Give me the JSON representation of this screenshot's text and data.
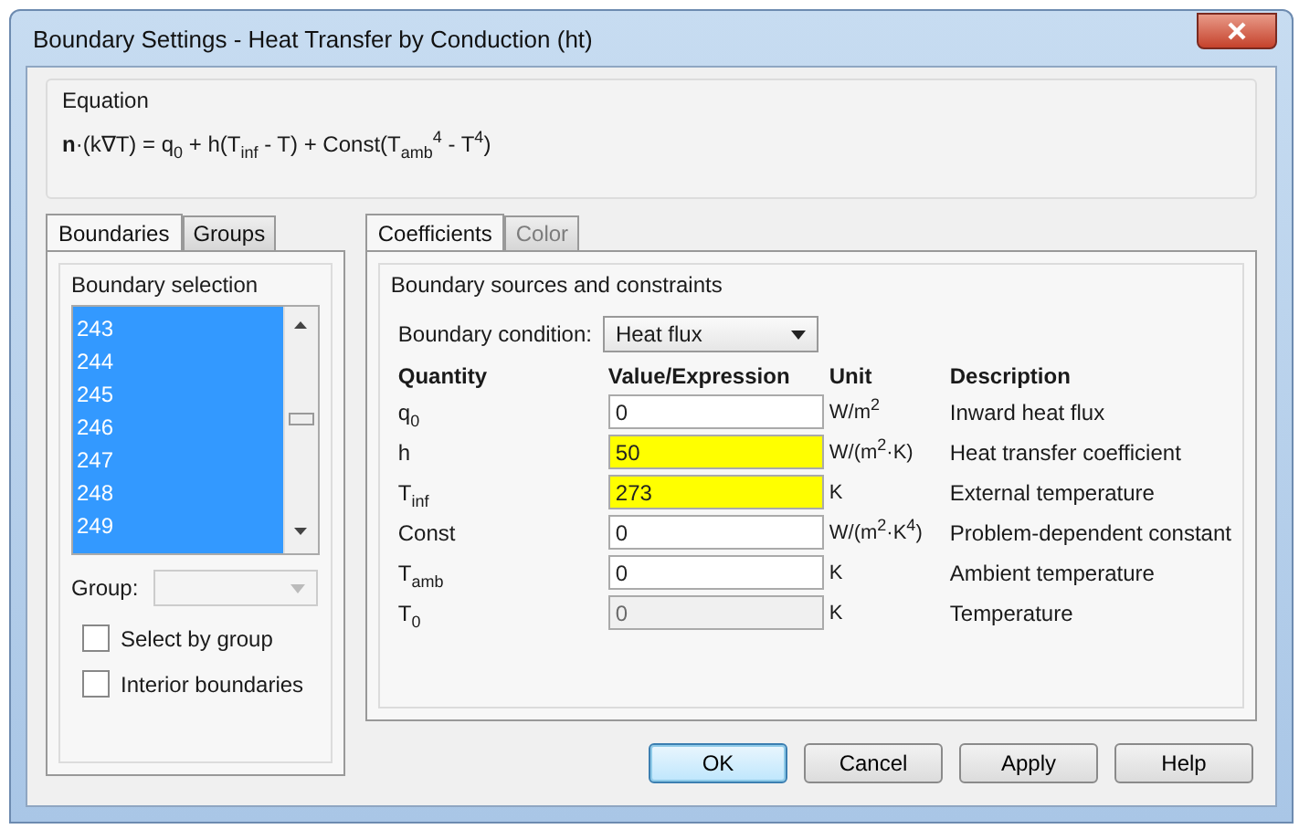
{
  "window": {
    "title": "Boundary Settings - Heat Transfer by Conduction (ht)"
  },
  "equation": {
    "label": "Equation",
    "formula": "**n**·(k∇T) = q$_{0}$ + h(T$_{inf}$ - T) + Const(T$_{amb}$$^{4}$ - T$^{4}$)"
  },
  "left_tabs": [
    {
      "label": "Boundaries",
      "selected": true
    },
    {
      "label": "Groups",
      "selected": false
    }
  ],
  "boundary_selection": {
    "label": "Boundary selection",
    "items": [
      {
        "label": "243",
        "selected": true
      },
      {
        "label": "244",
        "selected": true
      },
      {
        "label": "245",
        "selected": true
      },
      {
        "label": "246",
        "selected": true
      },
      {
        "label": "247",
        "selected": true
      },
      {
        "label": "248",
        "selected": true
      },
      {
        "label": "249",
        "selected": true
      }
    ]
  },
  "group": {
    "label": "Group:",
    "disabled": true
  },
  "checkboxes": [
    {
      "label": "Select by group",
      "checked": false
    },
    {
      "label": "Interior boundaries",
      "checked": false
    }
  ],
  "right_tabs": [
    {
      "label": "Coefficients",
      "selected": true,
      "disabled": false
    },
    {
      "label": "Color",
      "selected": false,
      "disabled": true
    }
  ],
  "sources": {
    "label": "Boundary sources and constraints",
    "condition_label": "Boundary condition:",
    "condition_value": "Heat flux",
    "columns": [
      "Quantity",
      "Value/Expression",
      "Unit",
      "Description"
    ],
    "rows": [
      {
        "quantity": "q$_{0}$",
        "value": "0",
        "unit": "W/m$^{2}$",
        "description": "Inward heat flux",
        "highlighted": false,
        "disabled": false
      },
      {
        "quantity": "h",
        "value": "50",
        "unit": "W/(m$^{2}$·K)",
        "description": "Heat transfer coefficient",
        "highlighted": true,
        "disabled": false
      },
      {
        "quantity": "T$_{inf}$",
        "value": "273",
        "unit": "K",
        "description": "External temperature",
        "highlighted": true,
        "disabled": false
      },
      {
        "quantity": "Const",
        "value": "0",
        "unit": "W/(m$^{2}$·K$^{4}$)",
        "description": "Problem-dependent constant",
        "highlighted": false,
        "disabled": false
      },
      {
        "quantity": "T$_{amb}$",
        "value": "0",
        "unit": "K",
        "description": "Ambient temperature",
        "highlighted": false,
        "disabled": false
      },
      {
        "quantity": "T$_{0}$",
        "value": "0",
        "unit": "K",
        "description": "Temperature",
        "highlighted": false,
        "disabled": true
      }
    ]
  },
  "buttons": [
    {
      "label": "OK",
      "default": true
    },
    {
      "label": "Cancel",
      "default": false
    },
    {
      "label": "Apply",
      "default": false
    },
    {
      "label": "Help",
      "default": false
    }
  ]
}
